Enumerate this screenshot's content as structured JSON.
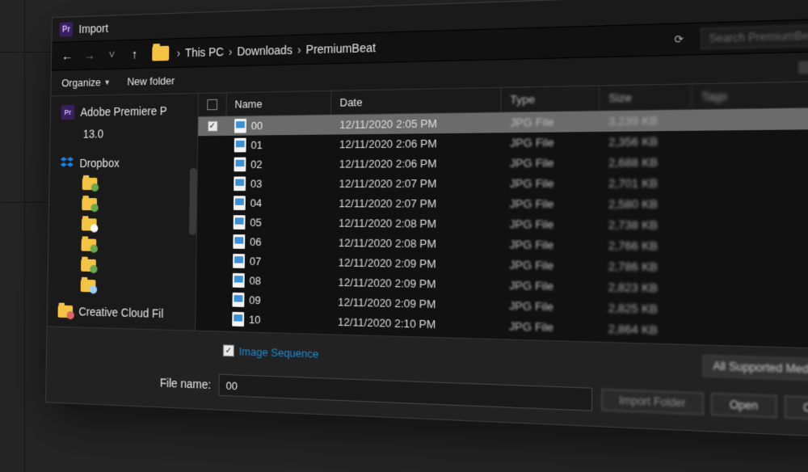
{
  "window": {
    "title": "Import",
    "app_badge": "Pr"
  },
  "nav": {
    "back": "←",
    "forward": "→",
    "recent": "˅",
    "up": "↑",
    "crumbs": [
      "This PC",
      "Downloads",
      "PremiumBeat"
    ],
    "sep": "›",
    "search_placeholder": "Search PremiumBeat"
  },
  "toolbar": {
    "organize": "Organize",
    "new_folder": "New folder"
  },
  "sidebar": {
    "items": [
      {
        "kind": "pr",
        "label": "Adobe Premiere P"
      },
      {
        "kind": "plain",
        "label": "13.0",
        "indent": true
      },
      {
        "kind": "db",
        "label": "Dropbox"
      },
      {
        "kind": "folder",
        "label": "",
        "badge": "#6aa84f"
      },
      {
        "kind": "folder",
        "label": "",
        "badge": "#6aa84f"
      },
      {
        "kind": "folder",
        "label": "",
        "badge": "#fff"
      },
      {
        "kind": "folder",
        "label": "",
        "badge": "#6aa84f"
      },
      {
        "kind": "folder",
        "label": "",
        "badge": "#6aa84f"
      },
      {
        "kind": "folder",
        "label": "",
        "badge": "#9bd0ff"
      },
      {
        "kind": "cc",
        "label": "Creative Cloud Fil"
      }
    ]
  },
  "columns": {
    "name": "Name",
    "date": "Date",
    "type": "Type",
    "size": "Size",
    "tags": "Tags"
  },
  "files": [
    {
      "name": "00",
      "date": "12/11/2020 2:05 PM",
      "type": "JPG File",
      "size": "3,239 KB",
      "selected": true,
      "checked": true
    },
    {
      "name": "01",
      "date": "12/11/2020 2:06 PM",
      "type": "JPG File",
      "size": "2,356 KB"
    },
    {
      "name": "02",
      "date": "12/11/2020 2:06 PM",
      "type": "JPG File",
      "size": "2,688 KB"
    },
    {
      "name": "03",
      "date": "12/11/2020 2:07 PM",
      "type": "JPG File",
      "size": "2,701 KB"
    },
    {
      "name": "04",
      "date": "12/11/2020 2:07 PM",
      "type": "JPG File",
      "size": "2,580 KB"
    },
    {
      "name": "05",
      "date": "12/11/2020 2:08 PM",
      "type": "JPG File",
      "size": "2,738 KB"
    },
    {
      "name": "06",
      "date": "12/11/2020 2:08 PM",
      "type": "JPG File",
      "size": "2,766 KB"
    },
    {
      "name": "07",
      "date": "12/11/2020 2:09 PM",
      "type": "JPG File",
      "size": "2,786 KB"
    },
    {
      "name": "08",
      "date": "12/11/2020 2:09 PM",
      "type": "JPG File",
      "size": "2,823 KB"
    },
    {
      "name": "09",
      "date": "12/11/2020 2:09 PM",
      "type": "JPG File",
      "size": "2,825 KB"
    },
    {
      "name": "10",
      "date": "12/11/2020 2:10 PM",
      "type": "JPG File",
      "size": "2,864 KB"
    }
  ],
  "options": {
    "image_sequence_label": "Image Sequence",
    "image_sequence_checked": true,
    "filter_label": "All Supported Media"
  },
  "filename": {
    "label": "File name:",
    "value": "00"
  },
  "buttons": {
    "import_folder": "Import Folder",
    "open": "Open",
    "cancel": "Cancel"
  }
}
